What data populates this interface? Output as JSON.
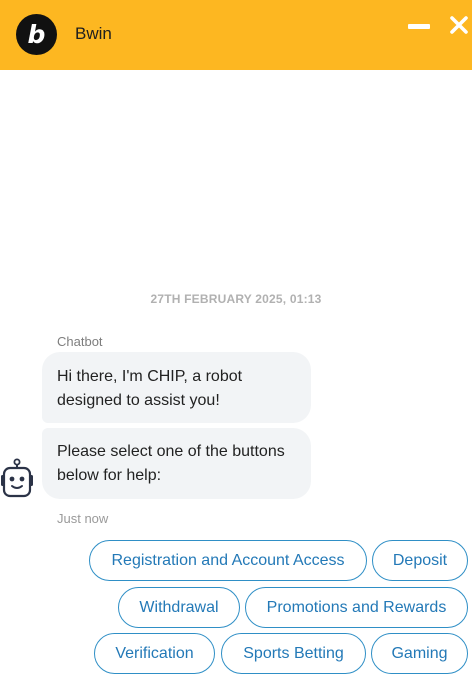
{
  "header": {
    "logo_letter": "b",
    "title": "Bwin",
    "background": "#fdb721",
    "minimize_icon": "minimize-icon",
    "close_icon": "close-icon"
  },
  "conversation": {
    "date_separator": "27TH FEBRUARY 2025, 01:13",
    "sender_name": "Chatbot",
    "messages": [
      {
        "text_lines": [
          "Hi there, I'm CHIP, a robot",
          "designed to assist you!"
        ]
      },
      {
        "text_lines": [
          "Please select one of the buttons",
          "below for help:"
        ]
      }
    ],
    "timestamp": "Just now",
    "avatar_icon": "robot-icon"
  },
  "quick_replies": [
    {
      "label": "Registration and Account Access"
    },
    {
      "label": "Deposit"
    },
    {
      "label": "Withdrawal"
    },
    {
      "label": "Promotions and Rewards"
    },
    {
      "label": "Verification"
    },
    {
      "label": "Sports Betting"
    },
    {
      "label": "Gaming"
    }
  ],
  "colors": {
    "accent": "#fdb721",
    "button_border": "#2f8fc6",
    "button_text": "#2379b7",
    "bubble_background": "#f2f4f6"
  }
}
